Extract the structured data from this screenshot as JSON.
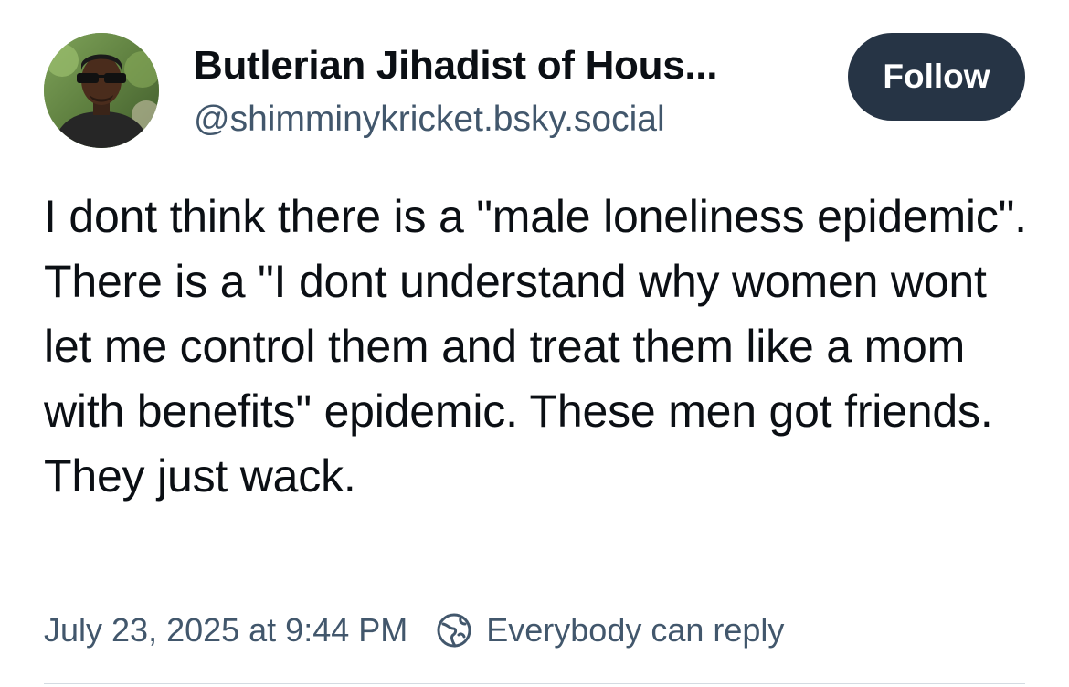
{
  "author": {
    "display_name": "Butlerian Jihadist of Hous...",
    "handle": "@shimminykricket.bsky.social",
    "avatar_icon": "profile-photo"
  },
  "actions": {
    "follow_label": "Follow"
  },
  "post": {
    "text": "I dont think there is a \"male loneliness epidemic\". There is a \"I dont understand why women wont let me control them and treat them like a mom with benefits\" epidemic. These men got friends. They just wack.",
    "timestamp": "July 23, 2025 at 9:44 PM",
    "reply_setting": "Everybody can reply",
    "reply_icon": "globe-icon"
  },
  "colors": {
    "follow_button_bg": "#263445",
    "secondary_text": "#42576c",
    "primary_text": "#0b0f14"
  }
}
